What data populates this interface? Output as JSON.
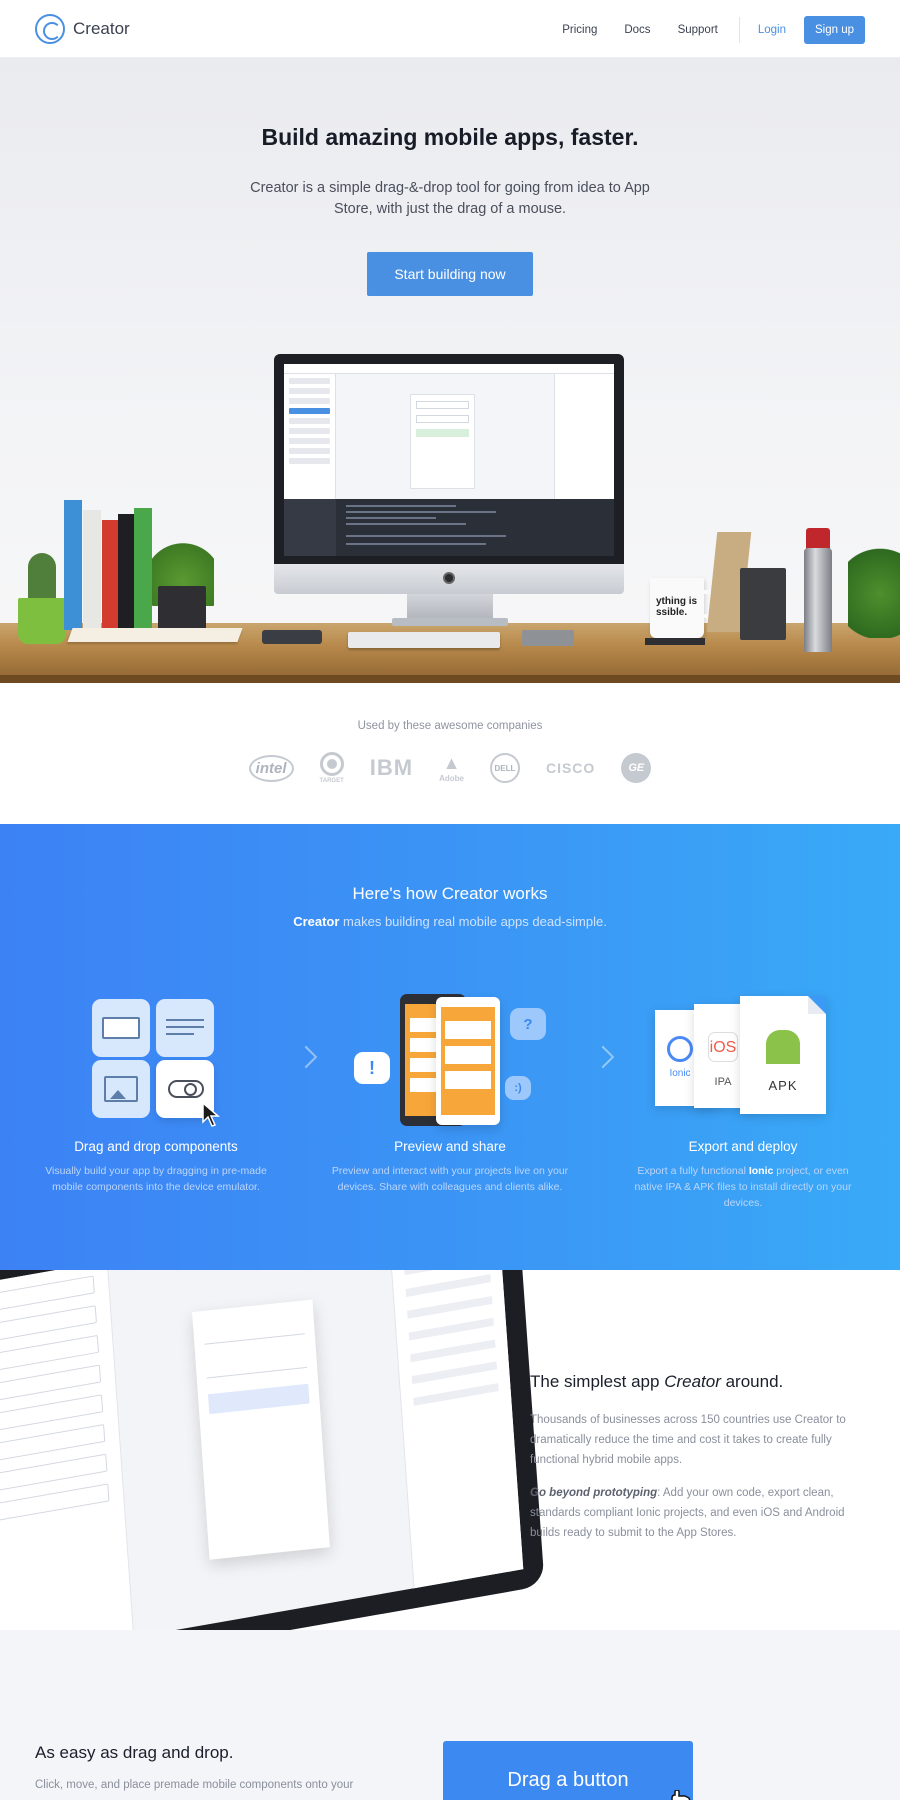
{
  "nav": {
    "brand": "Creator",
    "links": [
      "Pricing",
      "Docs",
      "Support"
    ],
    "login": "Login",
    "signup": "Sign up"
  },
  "hero": {
    "title": "Build amazing mobile apps, faster.",
    "subtitle": "Creator is a simple drag-&-drop tool for going from idea to App Store, with just the drag of a mouse.",
    "cta": "Start building now",
    "mug_text": "ything is\nssible."
  },
  "companies": {
    "caption": "Used by these awesome companies",
    "logos": [
      "intel",
      "TARGET",
      "IBM",
      "Adobe",
      "DELL",
      "CISCO",
      "GE"
    ]
  },
  "how": {
    "title": "Here's how Creator works",
    "subtitle_brand": "Creator",
    "subtitle_rest": " makes building real mobile apps dead-simple.",
    "steps": [
      {
        "title": "Drag and drop components",
        "desc": "Visually build your app by dragging in pre-made mobile components into the device emulator."
      },
      {
        "title": "Preview and share",
        "desc": "Preview and interact with your projects live on your devices. Share with colleagues and clients alike."
      },
      {
        "title": "Export and deploy",
        "desc_pre": "Export a fully functional ",
        "desc_bold": "Ionic",
        "desc_post": " project, or even native IPA & APK files to install directly on your devices."
      }
    ],
    "doc_labels": [
      "Ionic",
      "iOS",
      "IPA",
      "APK"
    ],
    "bubbles": [
      "!",
      "?",
      ":)"
    ]
  },
  "simplest": {
    "title_pre": "The simplest app ",
    "title_em": "Creator",
    "title_post": " around.",
    "p1": "Thousands of businesses across 150 countries use Creator to dramatically reduce the time and cost it takes to create fully functional hybrid mobile apps.",
    "p2_bold": "Go beyond prototyping",
    "p2_rest": ": Add your own code, export clean, standards compliant Ionic projects, and even iOS and Android builds ready to submit to the App Stores."
  },
  "drag": {
    "title": "As easy as drag and drop.",
    "desc": "Click, move, and place premade mobile components onto your",
    "button": "Drag a button"
  },
  "colors": {
    "accent": "#4a90e2",
    "how_bg_start": "#3c82f5",
    "how_bg_end": "#39aaf7",
    "orange": "#f7a739"
  }
}
